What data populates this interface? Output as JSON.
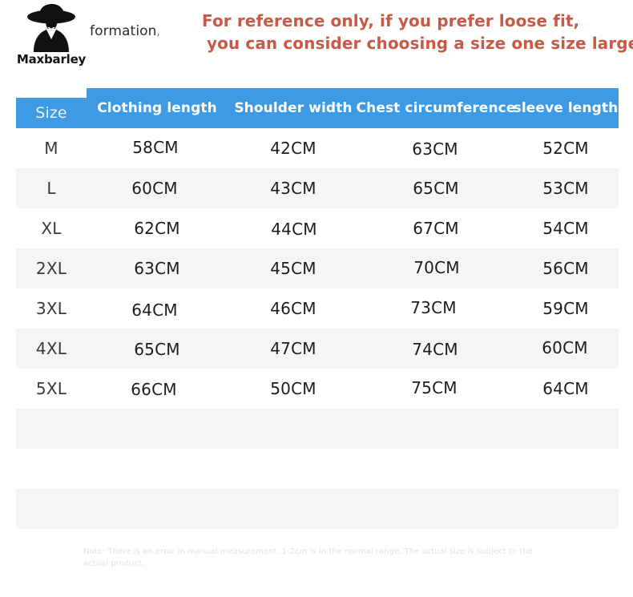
{
  "brand": {
    "name": "Maxbarley",
    "logo_icon": "woman-in-hat-silhouette-icon"
  },
  "header": {
    "partial_title": "formation",
    "partial_title_comma": ",",
    "notice_line_1": "For reference only, if you prefer loose fit,",
    "notice_line_2": "you can consider choosing a size one size larger",
    "notice_color": "#c65a46"
  },
  "table": {
    "header_bg": "#3f9ae4",
    "stripe_color": "#f5f5f5",
    "columns": [
      "Size",
      "Clothing length",
      "Shoulder width",
      "Chest circumference",
      "sleeve length"
    ],
    "rows": [
      {
        "size": "M",
        "clothing_length": "58CM",
        "shoulder_width": "42CM",
        "chest_circumference": "63CM",
        "sleeve_length": "52CM"
      },
      {
        "size": "L",
        "clothing_length": "60CM",
        "shoulder_width": "43CM",
        "chest_circumference": "65CM",
        "sleeve_length": "53CM"
      },
      {
        "size": "XL",
        "clothing_length": "62CM",
        "shoulder_width": "44CM",
        "chest_circumference": "67CM",
        "sleeve_length": "54CM"
      },
      {
        "size": "2XL",
        "clothing_length": "63CM",
        "shoulder_width": "45CM",
        "chest_circumference": "70CM",
        "sleeve_length": "56CM"
      },
      {
        "size": "3XL",
        "clothing_length": "64CM",
        "shoulder_width": "46CM",
        "chest_circumference": "73CM",
        "sleeve_length": "59CM"
      },
      {
        "size": "4XL",
        "clothing_length": "65CM",
        "shoulder_width": "47CM",
        "chest_circumference": "74CM",
        "sleeve_length": "60CM"
      },
      {
        "size": "5XL",
        "clothing_length": "66CM",
        "shoulder_width": "50CM",
        "chest_circumference": "75CM",
        "sleeve_length": "64CM"
      }
    ]
  },
  "footnote": {
    "text": "Note: There is an error in manual measurement. 1-2cm is in the normal range. The actual size is subject to the actual product."
  }
}
